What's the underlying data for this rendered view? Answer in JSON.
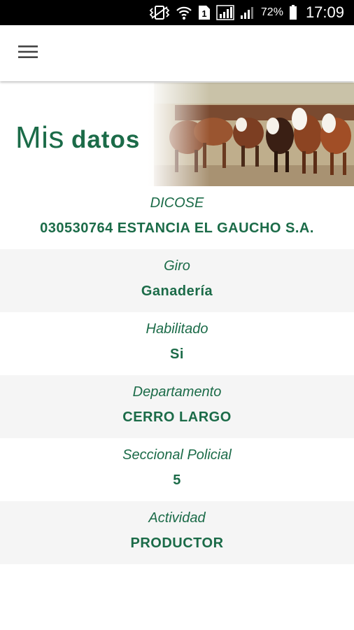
{
  "status_bar": {
    "battery_percent": "72%",
    "time": "17:09",
    "icons": [
      "vibrate-icon",
      "wifi-icon",
      "sim-1-icon",
      "signal-icon",
      "signal-icon",
      "battery-icon"
    ]
  },
  "app_bar": {
    "menu_icon": "hamburger-menu-icon"
  },
  "banner": {
    "title_light": "Mis",
    "title_bold": "datos",
    "image": "herd-of-hereford-cattle"
  },
  "colors": {
    "brand_green": "#1b6b48",
    "row_alt_bg": "#f5f5f5"
  },
  "fields": [
    {
      "label": "DICOSE",
      "value": "030530764 ESTANCIA EL GAUCHO S.A."
    },
    {
      "label": "Giro",
      "value": "Ganadería"
    },
    {
      "label": "Habilitado",
      "value": "Si"
    },
    {
      "label": "Departamento",
      "value": "CERRO LARGO"
    },
    {
      "label": "Seccional Policial",
      "value": "5"
    },
    {
      "label": "Actividad",
      "value": "PRODUCTOR"
    }
  ]
}
